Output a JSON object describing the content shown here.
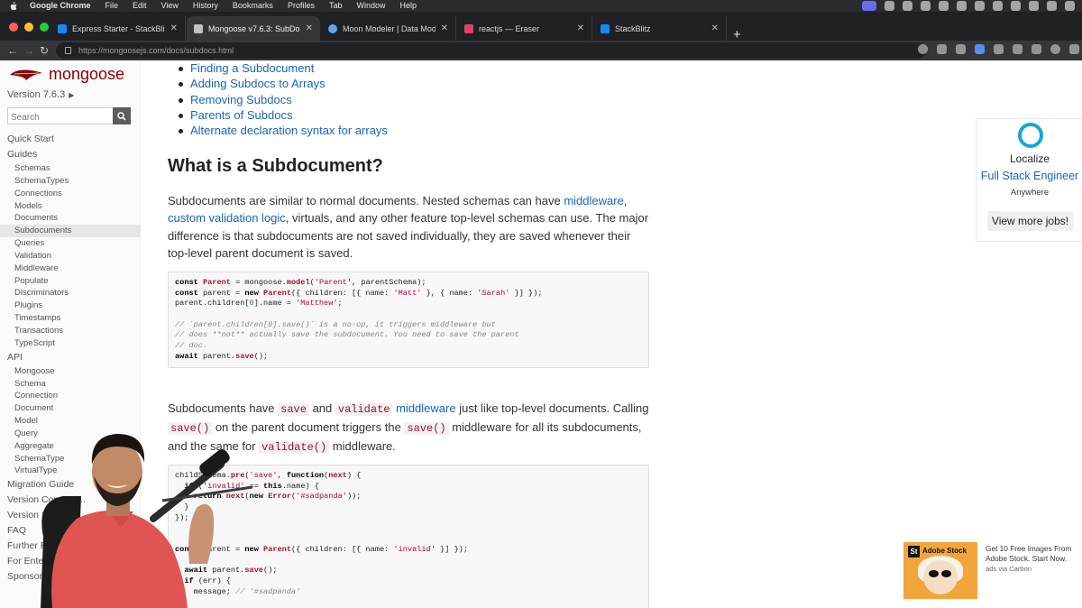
{
  "menubar": {
    "app": "Google Chrome",
    "items": [
      "File",
      "Edit",
      "View",
      "History",
      "Bookmarks",
      "Profiles",
      "Tab",
      "Window",
      "Help"
    ]
  },
  "tabs": [
    {
      "label": "Express Starter - StackBlitz",
      "favicon_color": "#1389fd",
      "active": false
    },
    {
      "label": "Mongoose v7.6.3: SubDocum…",
      "favicon_color": "#c1c1c1",
      "active": true
    },
    {
      "label": "Moon Modeler | Data Modeling…",
      "favicon_color": "#5aa8f0",
      "active": false
    },
    {
      "label": "reactjs — Eraser",
      "favicon_color": "#e0416b",
      "active": false
    },
    {
      "label": "StackBlitz",
      "favicon_color": "#1389fd",
      "active": false
    }
  ],
  "address": {
    "url": "https://mongoosejs.com/docs/subdocs.html"
  },
  "sidebar": {
    "brand": "mongoose",
    "version": "Version 7.6.3",
    "search_placeholder": "Search",
    "nav": [
      {
        "label": "Quick Start",
        "level": 1
      },
      {
        "label": "Guides",
        "level": 1
      },
      {
        "label": "Schemas",
        "level": 2
      },
      {
        "label": "SchemaTypes",
        "level": 2
      },
      {
        "label": "Connections",
        "level": 2
      },
      {
        "label": "Models",
        "level": 2
      },
      {
        "label": "Documents",
        "level": 2
      },
      {
        "label": "Subdocuments",
        "level": 2,
        "active": true
      },
      {
        "label": "Queries",
        "level": 2
      },
      {
        "label": "Validation",
        "level": 2
      },
      {
        "label": "Middleware",
        "level": 2
      },
      {
        "label": "Populate",
        "level": 2
      },
      {
        "label": "Discriminators",
        "level": 2
      },
      {
        "label": "Plugins",
        "level": 2
      },
      {
        "label": "Timestamps",
        "level": 2
      },
      {
        "label": "Transactions",
        "level": 2
      },
      {
        "label": "TypeScript",
        "level": 2
      },
      {
        "label": "API",
        "level": 1
      },
      {
        "label": "Mongoose",
        "level": 2
      },
      {
        "label": "Schema",
        "level": 2
      },
      {
        "label": "Connection",
        "level": 2
      },
      {
        "label": "Document",
        "level": 2
      },
      {
        "label": "Model",
        "level": 2
      },
      {
        "label": "Query",
        "level": 2
      },
      {
        "label": "Aggregate",
        "level": 2
      },
      {
        "label": "SchemaType",
        "level": 2
      },
      {
        "label": "VirtualType",
        "level": 2
      },
      {
        "label": "Migration Guide",
        "level": 1
      },
      {
        "label": "Version Compati…",
        "level": 1
      },
      {
        "label": "Version S…",
        "level": 1
      },
      {
        "label": "FAQ",
        "level": 1
      },
      {
        "label": "Further R…",
        "level": 1
      },
      {
        "label": "For Enter…",
        "level": 1
      },
      {
        "label": "Sponsors",
        "level": 1
      }
    ]
  },
  "content": {
    "toc": [
      "Finding a Subdocument",
      "Adding Subdocs to Arrays",
      "Removing Subdocs",
      "Parents of Subdocs",
      "Alternate declaration syntax for arrays"
    ],
    "heading": "What is a Subdocument?",
    "p1": {
      "t1": "Subdocuments are similar to normal documents. Nested schemas can have ",
      "l1": "middleware",
      "t2": ", ",
      "l2": "custom validation logic",
      "t3": ", virtuals, and any other feature top-level schemas can use. The major difference is that subdocuments are not saved individually, they are saved whenever their top-level parent document is saved."
    },
    "code1": [
      "const Parent = mongoose.model('Parent', parentSchema);",
      "const parent = new Parent({ children: [{ name: 'Matt' }, { name: 'Sarah' }] });",
      "parent.children[0].name = 'Matthew';",
      "",
      "// `parent.children[0].save()` is a no-op, it triggers middleware but",
      "// does **not** actually save the subdocument. You need to save the parent",
      "// doc.",
      "await parent.save();"
    ],
    "p2": {
      "t1": "Subdocuments have ",
      "c1": "save",
      "t2": " and ",
      "c2": "validate",
      "t3": " ",
      "l1": "middleware",
      "t4": " just like top-level documents. Calling ",
      "c3": "save()",
      "t5": " on the parent document triggers the ",
      "c4": "save()",
      "t6": " middleware for all its subdocuments, and the same for ",
      "c5": "validate()",
      "t7": " middleware."
    },
    "code2": [
      "childSchema.pre('save', function(next) {",
      "  if ('invalid' == this.name) {",
      "    return next(new Error('#sadpanda'));",
      "  }",
      "});",
      "",
      "",
      "const parent = new Parent({ children: [{ name: 'invalid' }] });",
      "",
      "  await parent.save();",
      "  if (err) {",
      "    message; // '#sadpanda'",
      "}"
    ]
  },
  "jobs_ad": {
    "company": "Localize",
    "role": "Full Stack Engineer",
    "location": "Anywhere",
    "button": "View more jobs!"
  },
  "carbon_ad": {
    "logo_text": "St",
    "brand": "Adobe Stock",
    "text": "Get 10 Free Images From Adobe Stock. Start Now.",
    "via": "ads via Carbon"
  },
  "colors": {
    "link": "#1565c0",
    "brand": "#880000",
    "code_fn": "#a3102a",
    "menubar": "#2b2b2d",
    "tabstrip": "#202124"
  }
}
